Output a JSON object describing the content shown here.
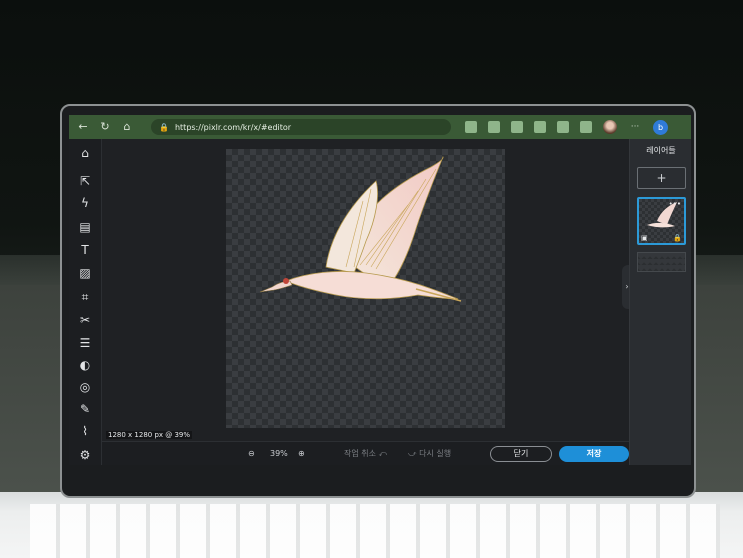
{
  "browser": {
    "url": "https://pixlr.com/kr/x/#editor",
    "back_icon": "←",
    "refresh_icon": "↻",
    "home_icon": "⌂",
    "lock_icon": "🔒",
    "more_icon": "···",
    "bing_label": "b"
  },
  "toolbar": {
    "home": "⌂",
    "arrange": "⇱",
    "quick": "ϟ",
    "template": "▤",
    "text": "T",
    "fill": "▨",
    "crop": "⌗",
    "cutout": "✂",
    "adjust": "☰",
    "filter": "◐",
    "liquify": "◎",
    "draw": "✎",
    "retouch": "⌇",
    "settings": "⚙"
  },
  "canvas": {
    "size_label": "1280 x 1280 px @ 39%"
  },
  "bottom": {
    "zoom_out": "⊖",
    "zoom": "39%",
    "zoom_in": "⊕",
    "undo": "작업 취소 ⤺",
    "redo": "⤻ 다시 실행",
    "close": "닫기",
    "save": "저장"
  },
  "layers": {
    "title": "레이어들",
    "add": "+",
    "more": "•••",
    "image_icon": "▣",
    "lock_icon": "🔒",
    "toggle": "›"
  },
  "colors": {
    "browser_bar": "#3a5a36",
    "accent": "#1e8fd8",
    "selection": "#2c9ad8"
  }
}
